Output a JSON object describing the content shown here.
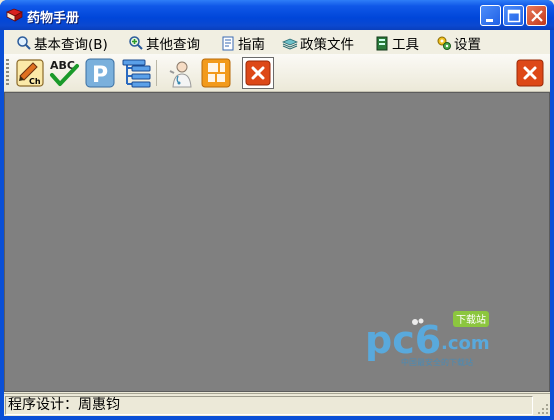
{
  "window": {
    "title": "药物手册"
  },
  "menu": [
    {
      "label": "基本查询(B)",
      "icon": "search-icon"
    },
    {
      "label": "其他查询",
      "icon": "search-plus-icon"
    },
    {
      "label": "指南",
      "icon": "document-icon"
    },
    {
      "label": "政策文件",
      "icon": "books-icon"
    },
    {
      "label": "工具",
      "icon": "toolbox-icon"
    },
    {
      "label": "设置",
      "icon": "settings-icon"
    }
  ],
  "toolbar": {
    "tools": [
      "pencil-ch-icon",
      "abc-check-icon",
      "p-icon",
      "tree-icon",
      "doctor-icon",
      "orange-tiles-icon",
      "close-x-icon"
    ],
    "close_button": "close-x-icon"
  },
  "status": {
    "text": "程序设计：周惠钧"
  },
  "watermark": {
    "main": "pc6",
    "tag": "下载站",
    "sub": ".com",
    "caption": "中国最安全的下载站"
  },
  "colors": {
    "titlebar": "#0046d9",
    "canvas": "#808080",
    "close_red": "#dd4818",
    "orange": "#f29a1c"
  }
}
